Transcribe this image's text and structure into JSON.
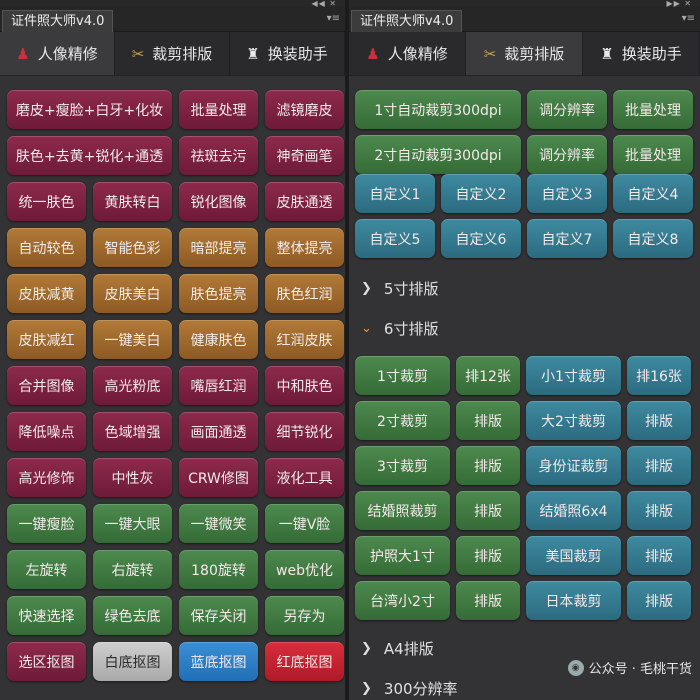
{
  "left": {
    "panel_title": "证件照大师v4.0",
    "tabs": [
      {
        "label": "人像精修",
        "icon": "bust-icon",
        "active": true
      },
      {
        "label": "裁剪排版",
        "icon": "scissors-icon",
        "active": false
      },
      {
        "label": "换装助手",
        "icon": "suit-icon",
        "active": false
      }
    ],
    "buttons": [
      [
        "磨皮+瘦脸+白牙+化妆",
        "批量处理",
        "滤镜磨皮"
      ],
      [
        "肤色+去黄+锐化+通透",
        "祛斑去污",
        "神奇画笔"
      ],
      [
        "统一肤色",
        "黄肤转白",
        "锐化图像",
        "皮肤通透"
      ],
      [
        "自动较色",
        "智能色彩",
        "暗部提亮",
        "整体提亮"
      ],
      [
        "皮肤减黄",
        "皮肤美白",
        "肤色提亮",
        "肤色红润"
      ],
      [
        "皮肤减红",
        "一键美白",
        "健康肤色",
        "红润皮肤"
      ],
      [
        "合并图像",
        "高光粉底",
        "嘴唇红润",
        "中和肤色"
      ],
      [
        "降低噪点",
        "色域增强",
        "画面通透",
        "细节锐化"
      ],
      [
        "高光修饰",
        "中性灰",
        "CRW修图",
        "液化工具"
      ],
      [
        "一键瘦脸",
        "一键大眼",
        "一键微笑",
        "一键V脸"
      ],
      [
        "左旋转",
        "右旋转",
        "180旋转",
        "web优化"
      ],
      [
        "快速选择",
        "绿色去底",
        "保存关闭",
        "另存为"
      ],
      [
        "选区抠图",
        "白底抠图",
        "蓝底抠图",
        "红底抠图"
      ]
    ]
  },
  "right": {
    "panel_title": "证件照大师v4.0",
    "tabs": [
      {
        "label": "人像精修",
        "icon": "bust-icon",
        "active": false
      },
      {
        "label": "裁剪排版",
        "icon": "scissors-icon",
        "active": true
      },
      {
        "label": "换装助手",
        "icon": "suit-icon",
        "active": false
      }
    ],
    "top_buttons": [
      [
        "1寸自动裁剪300dpi",
        "调分辨率",
        "批量处理"
      ],
      [
        "2寸自动裁剪300dpi",
        "调分辨率",
        "批量处理"
      ]
    ],
    "custom_buttons": [
      "自定义1",
      "自定义2",
      "自定义3",
      "自定义4",
      "自定义5",
      "自定义6",
      "自定义7",
      "自定义8"
    ],
    "sections": [
      {
        "label": "5寸排版",
        "expanded": false
      },
      {
        "label": "6寸排版",
        "expanded": true
      },
      {
        "label": "A4排版",
        "expanded": false
      },
      {
        "label": "300分辨率",
        "expanded": false
      }
    ],
    "six_inch_rows": [
      [
        "1寸裁剪",
        "排12张",
        "小1寸裁剪",
        "排16张"
      ],
      [
        "2寸裁剪",
        "排版",
        "大2寸裁剪",
        "排版"
      ],
      [
        "3寸裁剪",
        "排版",
        "身份证裁剪",
        "排版"
      ],
      [
        "结婚照裁剪",
        "排版",
        "结婚照6x4",
        "排版"
      ],
      [
        "护照大1寸",
        "排版",
        "美国裁剪",
        "排版"
      ],
      [
        "台湾小2寸",
        "排版",
        "日本裁剪",
        "排版"
      ]
    ]
  },
  "watermark": "公众号 · 毛桃干货",
  "colors": {
    "maroon": "#7e2444",
    "orange": "#a06c2e",
    "green": "#427a44",
    "teal": "#357b90",
    "white": "#bebebe",
    "blue": "#2e80c6",
    "red": "#c82432",
    "panel_bg": "#333335"
  }
}
